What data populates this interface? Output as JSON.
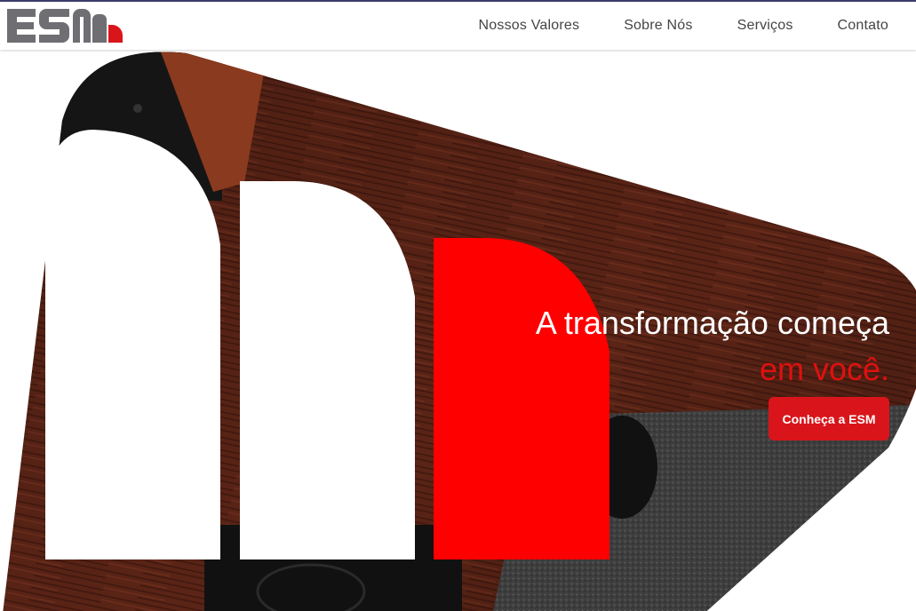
{
  "brand": {
    "logo_text": "ESM",
    "colors": {
      "accent": "#d9151b",
      "logo_grey": "#6e6e73",
      "headline_red": "#e01010",
      "nav_text": "#444444"
    }
  },
  "nav": {
    "items": [
      {
        "label": "Nossos Valores"
      },
      {
        "label": "Sobre Nós"
      },
      {
        "label": "Serviços"
      },
      {
        "label": "Contato"
      }
    ]
  },
  "hero": {
    "headline_line1": "A transformação começa",
    "headline_line2": "em você.",
    "cta_label": "Conheça a ESM"
  }
}
